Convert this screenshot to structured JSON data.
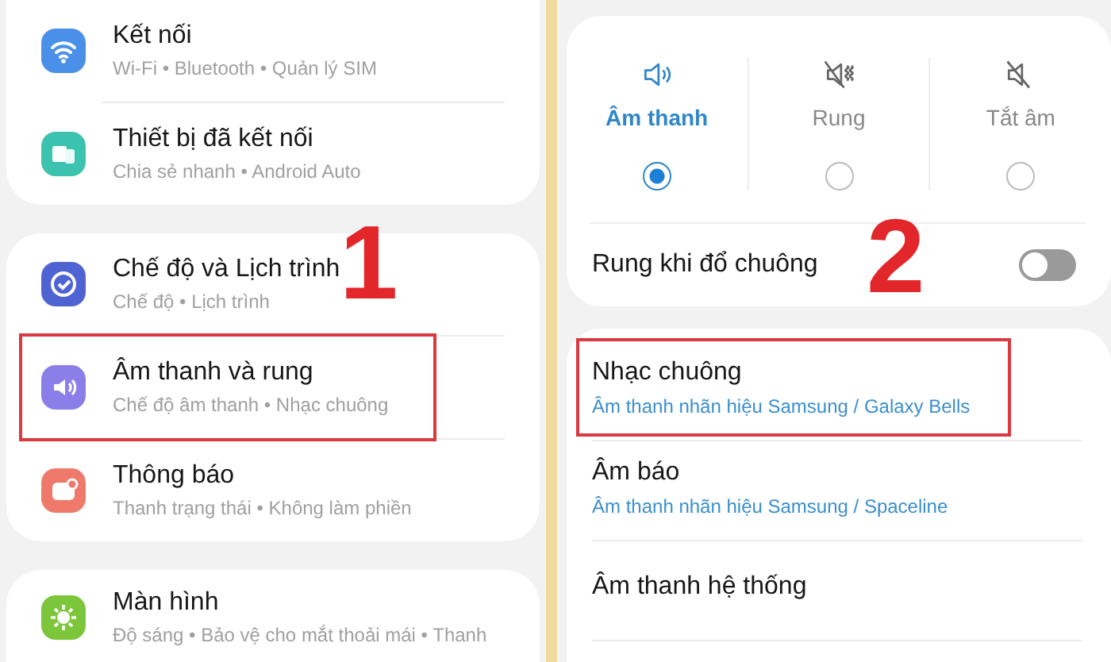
{
  "left_panel": {
    "step": "1",
    "groups": [
      [
        {
          "title": "Kết nối",
          "subtitle": "Wi-Fi • Bluetooth • Quản lý SIM",
          "kind": "wifi",
          "color": "#4a90e8",
          "highlighted": false
        },
        {
          "title": "Thiết bị đã kết nối",
          "subtitle": "Chia sẻ nhanh • Android Auto",
          "kind": "devices",
          "color": "#3cc3b0",
          "highlighted": false
        }
      ],
      [
        {
          "title": "Chế độ và Lịch trình",
          "subtitle": "Chế độ • Lịch trình",
          "kind": "check",
          "color": "#4f63d2",
          "highlighted": false
        },
        {
          "title": "Âm thanh và rung",
          "subtitle": "Chế độ âm thanh • Nhạc chuông",
          "kind": "sound",
          "color": "#8a7ee8",
          "highlighted": true
        },
        {
          "title": "Thông báo",
          "subtitle": "Thanh trạng thái • Không làm phiền",
          "kind": "notification",
          "color": "#ef7a6b",
          "highlighted": false
        }
      ],
      [
        {
          "title": "Màn hình",
          "subtitle": "Độ sáng • Bảo vệ cho mắt thoải mái • Thanh",
          "kind": "display",
          "color": "#7bc63a",
          "highlighted": false
        }
      ]
    ]
  },
  "right_panel": {
    "step": "2",
    "sound_modes": [
      {
        "label": "Âm thanh",
        "kind": "sound",
        "selected": true
      },
      {
        "label": "Rung",
        "kind": "vibrate",
        "selected": false
      },
      {
        "label": "Tắt âm",
        "kind": "mute",
        "selected": false
      }
    ],
    "vibrate_while_ringing": {
      "label": "Rung khi đổ chuông",
      "on": false
    },
    "items": [
      {
        "title": "Nhạc chuông",
        "subtitle": "Âm thanh nhãn hiệu Samsung / Galaxy Bells",
        "highlighted": true
      },
      {
        "title": "Âm báo",
        "subtitle": "Âm thanh nhãn hiệu Samsung / Spaceline",
        "highlighted": false
      },
      {
        "title": "Âm thanh hệ thống",
        "highlighted": false
      }
    ]
  }
}
